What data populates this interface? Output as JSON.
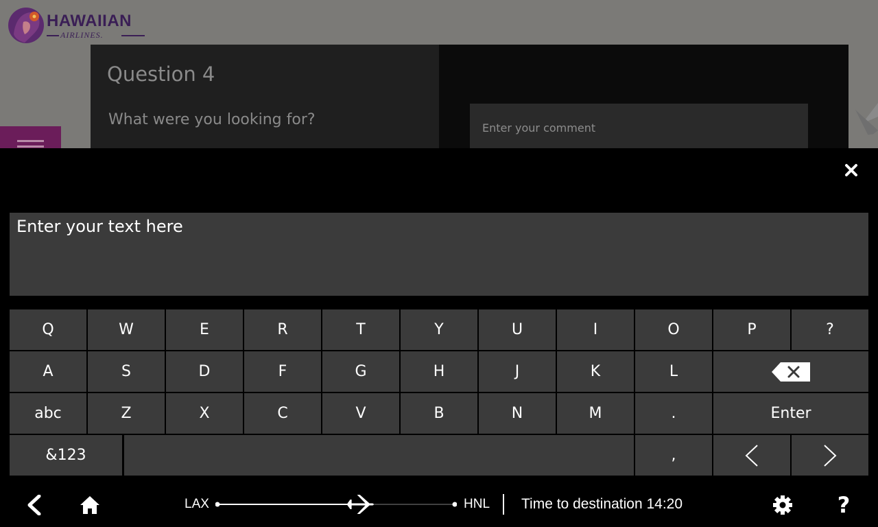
{
  "brand": {
    "name": "HAWAIIAN",
    "sub": "AIRLINES."
  },
  "survey": {
    "question_title": "Question 4",
    "question_text": "What were you looking for?",
    "comment_placeholder": "Enter your comment"
  },
  "keyboard": {
    "input_placeholder": "Enter your text here",
    "rows": [
      [
        "Q",
        "W",
        "E",
        "R",
        "T",
        "Y",
        "U",
        "I",
        "O",
        "P",
        "?"
      ],
      [
        "A",
        "S",
        "D",
        "F",
        "G",
        "H",
        "J",
        "K",
        "L"
      ],
      [
        "abc",
        "Z",
        "X",
        "C",
        "V",
        "B",
        "N",
        "M",
        "."
      ],
      [
        "&123",
        ","
      ]
    ],
    "enter_label": "Enter",
    "icons": {
      "close": "close-icon",
      "backspace": "backspace-icon",
      "arrow_left": "arrow-left-icon",
      "arrow_right": "arrow-right-icon"
    }
  },
  "flight": {
    "origin": "LAX",
    "destination": "HNL",
    "progress": 0.6,
    "time_to_destination": "Time to destination 14:20"
  },
  "nav": {
    "help_label": "?",
    "icons": [
      "back-icon",
      "home-icon",
      "gear-icon",
      "help-icon"
    ]
  },
  "colors": {
    "key_bg": "#3b3b3b",
    "overlay_bg": "#000000",
    "menu_tab": "#6b1d5a",
    "brand_purple": "#3a1e55"
  }
}
